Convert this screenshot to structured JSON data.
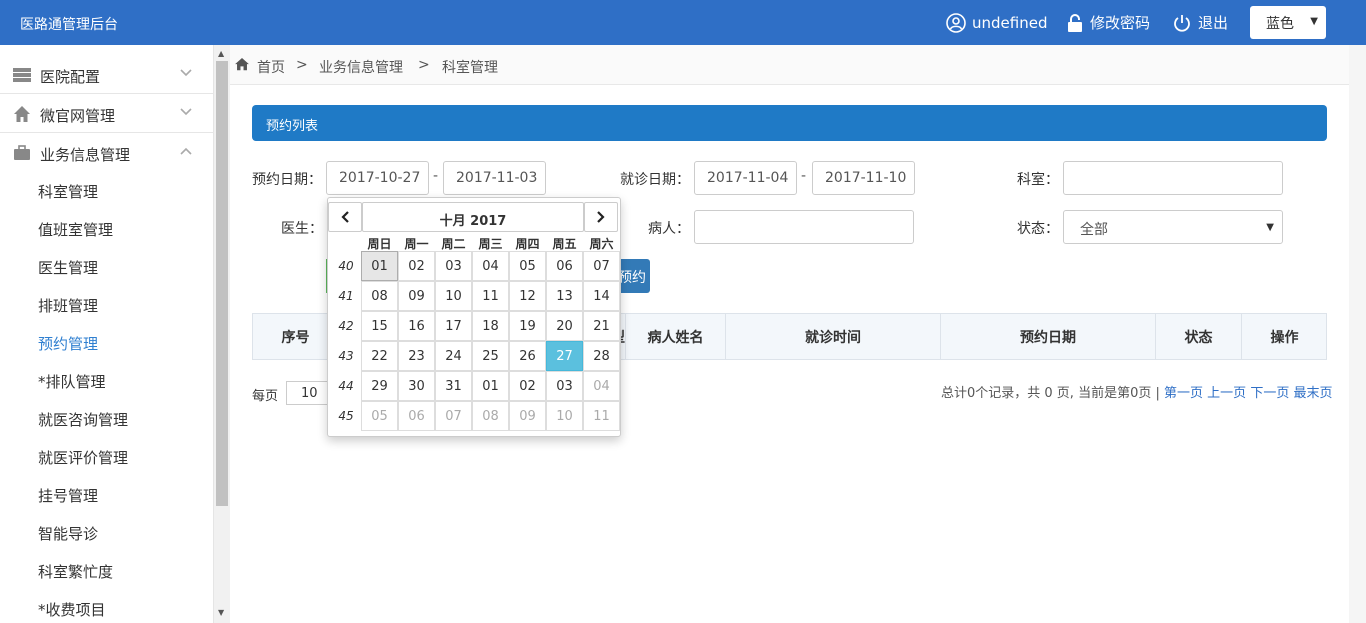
{
  "app": {
    "title": "医路通管理后台"
  },
  "header": {
    "user": "undefined",
    "change_password": "修改密码",
    "logout": "退出",
    "theme": "蓝色"
  },
  "sidebar": {
    "groups": [
      {
        "label": "医院配置",
        "icon": "server-icon"
      },
      {
        "label": "微官网管理",
        "icon": "home-icon"
      },
      {
        "label": "业务信息管理",
        "icon": "briefcase-icon"
      }
    ],
    "items": [
      {
        "label": "科室管理"
      },
      {
        "label": "值班室管理"
      },
      {
        "label": "医生管理"
      },
      {
        "label": "排班管理"
      },
      {
        "label": "预约管理",
        "active": true
      },
      {
        "label": "*排队管理"
      },
      {
        "label": "就医咨询管理"
      },
      {
        "label": "就医评价管理"
      },
      {
        "label": "挂号管理"
      },
      {
        "label": "智能导诊"
      },
      {
        "label": "科室繁忙度"
      },
      {
        "label": "*收费项目"
      }
    ]
  },
  "breadcrumb": {
    "home": "首页",
    "sep": ">",
    "section": "业务信息管理",
    "page": "科室管理"
  },
  "panel": {
    "title": "预约列表"
  },
  "filters": {
    "booking_date_label": "预约日期：",
    "booking_from": "2017-10-27",
    "booking_to": "2017-11-03",
    "range_sep": "-",
    "visit_date_label": "就诊日期：",
    "visit_from": "2017-11-04",
    "visit_to": "2017-11-10",
    "dept_label": "科室：",
    "dept_value": "",
    "doctor_label": "医生：",
    "patient_label": "病人：",
    "patient_value": "",
    "status_label": "状态：",
    "status_value": "全部",
    "query_button": "预约"
  },
  "table": {
    "headers": {
      "seq": "序号",
      "type_partial": "型",
      "patient_name": "病人姓名",
      "visit_time": "就诊时间",
      "booking_date": "预约日期",
      "status": "状态",
      "ops": "操作"
    }
  },
  "pager": {
    "per_page_label": "每页",
    "per_page_value": "10",
    "summary": "总计0个记录，共 0 页, 当前是第0页 | ",
    "first": "第一页",
    "prev": "上一页",
    "next": "下一页",
    "last": "最末页"
  },
  "datepicker": {
    "month_title": "十月 2017",
    "prev": "‹",
    "next": "›",
    "weekdays": [
      "周日",
      "周一",
      "周二",
      "周三",
      "周四",
      "周五",
      "周六"
    ],
    "weeks": [
      {
        "num": "40",
        "days": [
          "01",
          "02",
          "03",
          "04",
          "05",
          "06",
          "07"
        ]
      },
      {
        "num": "41",
        "days": [
          "08",
          "09",
          "10",
          "11",
          "12",
          "13",
          "14"
        ]
      },
      {
        "num": "42",
        "days": [
          "15",
          "16",
          "17",
          "18",
          "19",
          "20",
          "21"
        ]
      },
      {
        "num": "43",
        "days": [
          "22",
          "23",
          "24",
          "25",
          "26",
          "27",
          "28"
        ]
      },
      {
        "num": "44",
        "days": [
          "29",
          "30",
          "31",
          "01",
          "02",
          "03",
          "04"
        ]
      },
      {
        "num": "45",
        "days": [
          "05",
          "06",
          "07",
          "08",
          "09",
          "10",
          "11"
        ]
      }
    ],
    "selected": "27",
    "today": "01"
  }
}
